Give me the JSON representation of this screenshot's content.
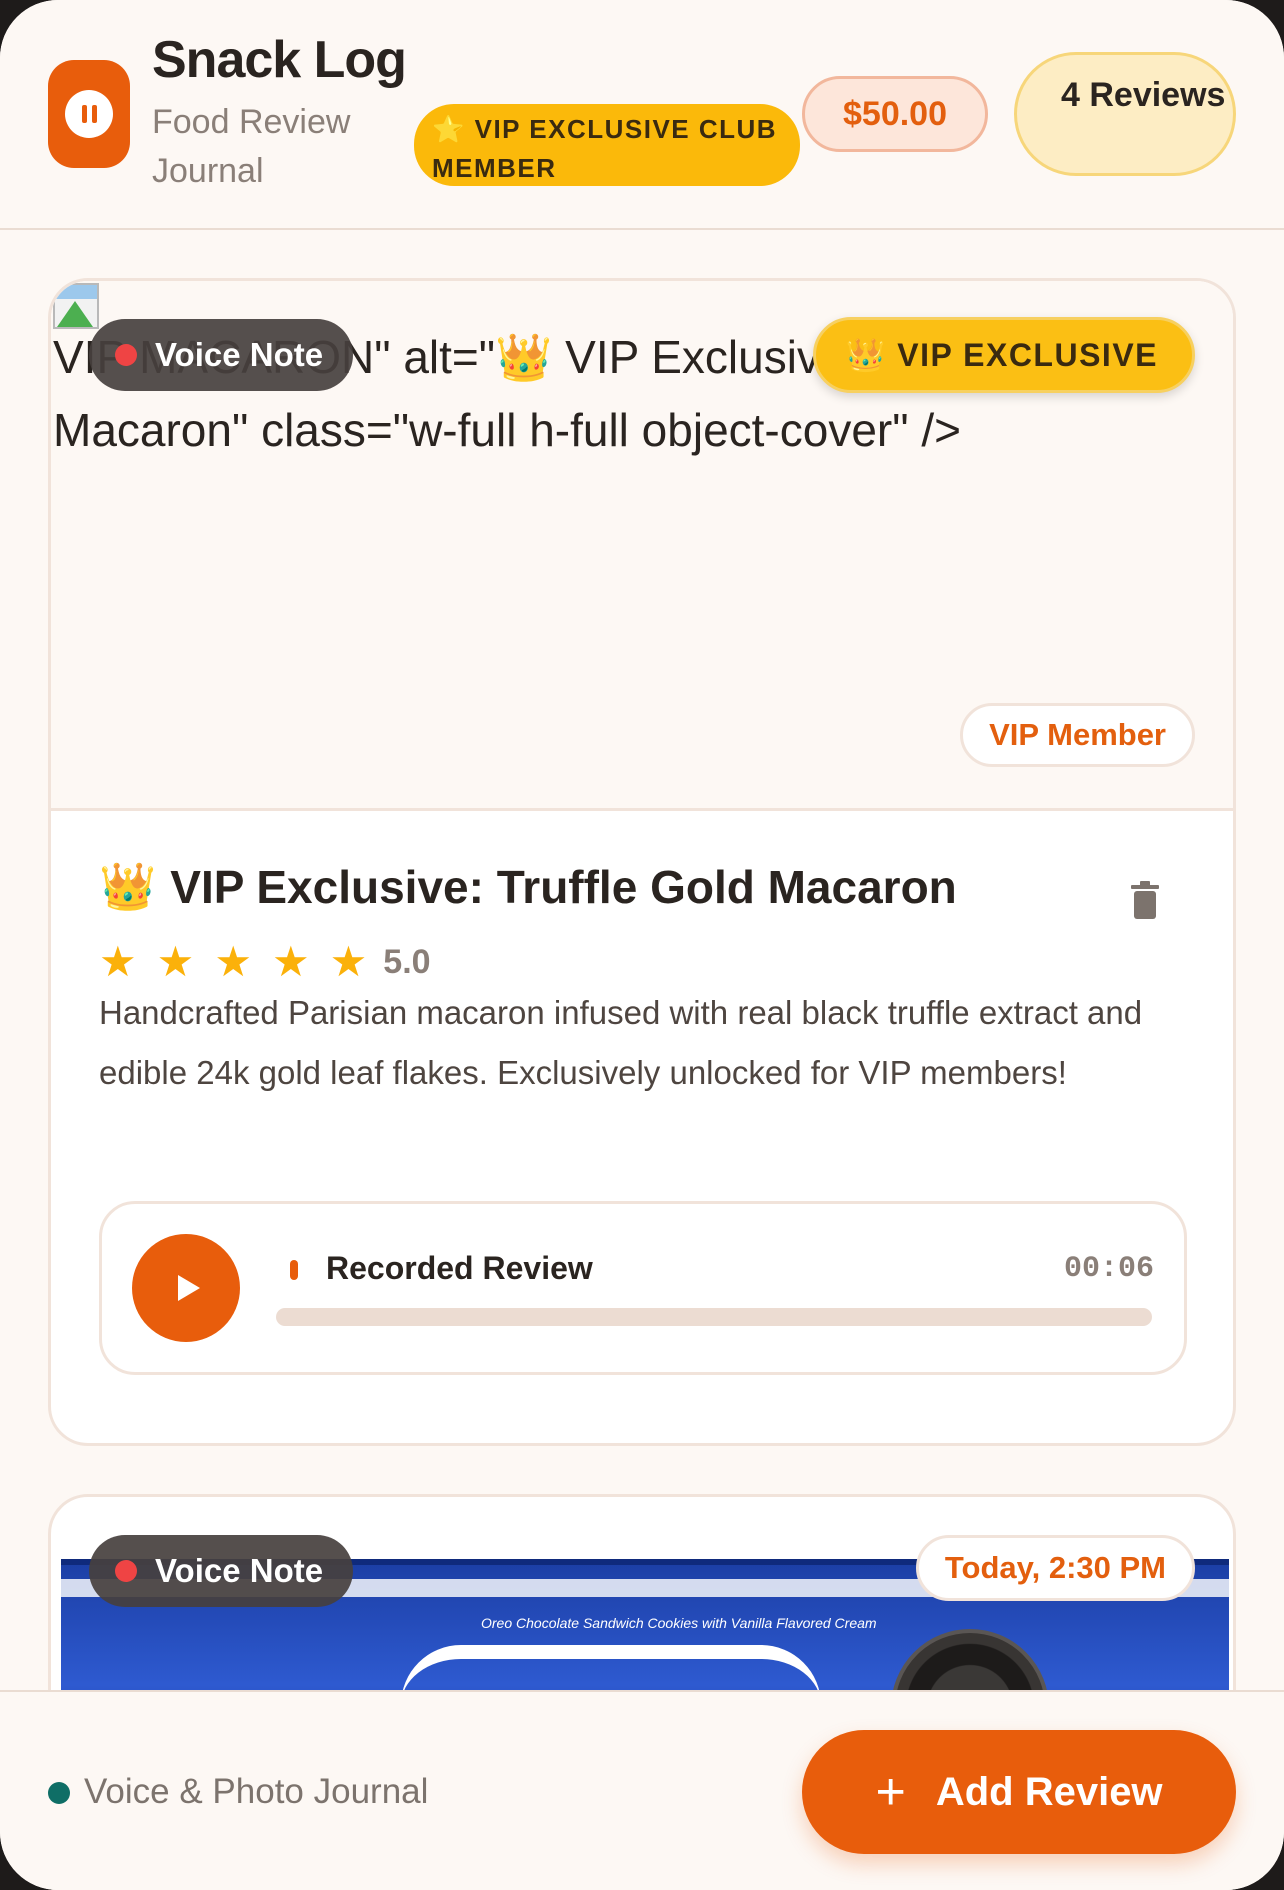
{
  "header": {
    "title": "Snack Log",
    "subtitle": "Food Review Journal",
    "vip_club_badge": "⭐ VIP EXCLUSIVE CLUB MEMBER",
    "balance": "$50.00",
    "reviews_count": "4 Reviews"
  },
  "cards": [
    {
      "alt_text": "VIP MACARON\" alt=\"👑 VIP Exclusive: Truffle Gold Macaron\" class=\"w-full h-full object-cover\" />",
      "voice_pill": "Voice Note",
      "vip_badge": "👑 VIP EXCLUSIVE",
      "vip_member_tag": "VIP Member",
      "title_emoji": "👑",
      "title": "VIP Exclusive: Truffle Gold Macaron",
      "rating": 5,
      "rating_text": "5.0",
      "description": "Handcrafted Parisian macaron infused with real black truffle extract and edible 24k gold leaf flakes. Exclusively unlocked for VIP members!",
      "player": {
        "label": "Recorded Review",
        "time": "00:06",
        "progress": 0
      }
    },
    {
      "voice_pill": "Voice Note",
      "date": "Today, 2:30 PM",
      "package_text": "Oreo Chocolate Sandwich Cookies with Vanilla Flavored Cream"
    }
  ],
  "footer": {
    "label": "Voice & Photo Journal",
    "add_button": "Add Review",
    "add_icon": "+"
  },
  "colors": {
    "accent": "#e85d0c",
    "vip_gold": "#fbb90a",
    "star": "#fbb10a",
    "status_dot": "#0f6e66"
  }
}
